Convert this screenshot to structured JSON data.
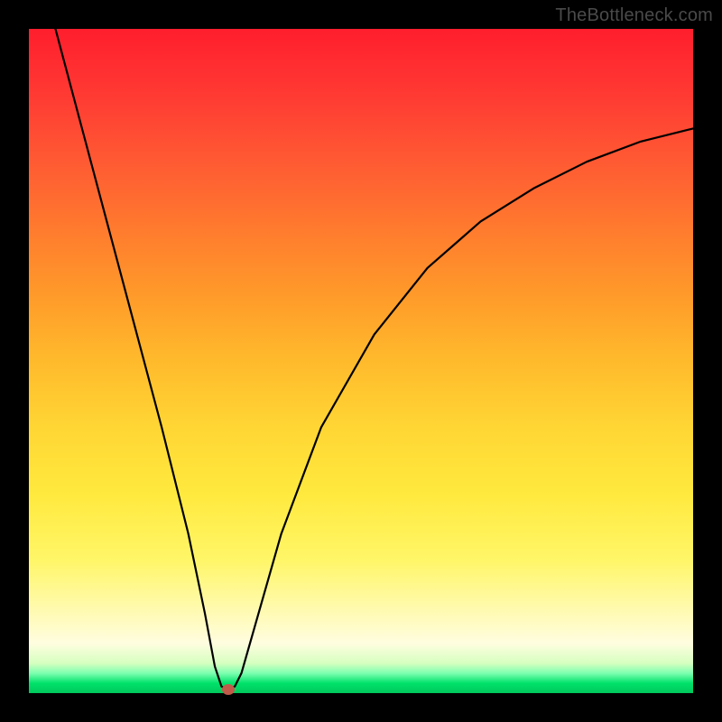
{
  "watermark": "TheBottleneck.com",
  "chart_data": {
    "type": "line",
    "title": "",
    "xlabel": "",
    "ylabel": "",
    "xlim": [
      0,
      100
    ],
    "ylim": [
      0,
      100
    ],
    "grid": false,
    "legend": false,
    "series": [
      {
        "name": "curve",
        "x": [
          4,
          8,
          12,
          16,
          20,
          24,
          26.5,
          28,
          29,
          30,
          31,
          32,
          34,
          38,
          44,
          52,
          60,
          68,
          76,
          84,
          92,
          100
        ],
        "y": [
          100,
          85,
          70,
          55,
          40,
          24,
          12,
          4,
          1,
          0.5,
          1,
          3,
          10,
          24,
          40,
          54,
          64,
          71,
          76,
          80,
          83,
          85
        ]
      }
    ],
    "marker": {
      "x": 30,
      "y": 0.5,
      "color": "#c25a4a"
    },
    "background_gradient": {
      "top": "#ff1e2d",
      "mid_upper": "#ff9a2a",
      "mid": "#ffe93e",
      "lower": "#fffde0",
      "bottom": "#00c85c"
    }
  }
}
